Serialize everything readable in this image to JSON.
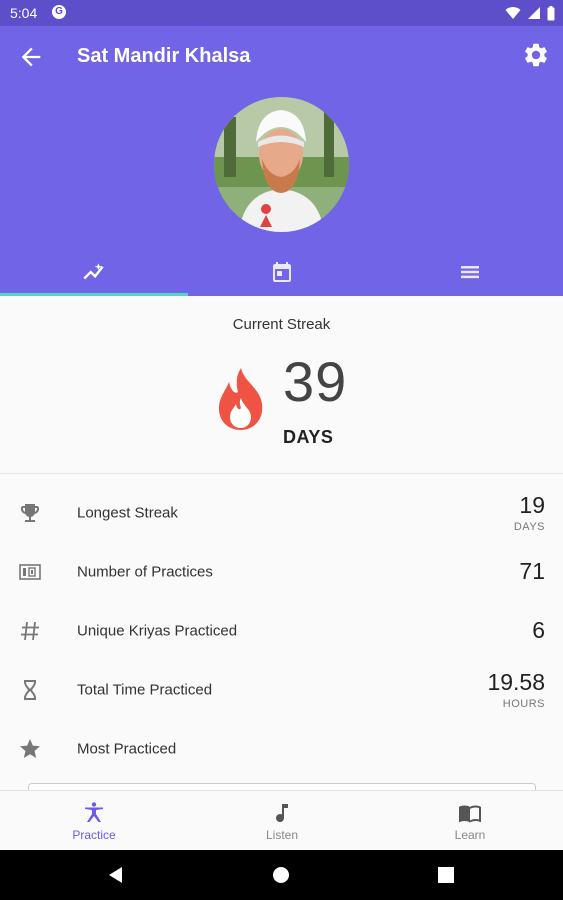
{
  "status_bar": {
    "time": "5:04",
    "g_icon": "G"
  },
  "header": {
    "title": "Sat Mandir Khalsa",
    "back_icon": "arrow-back-icon",
    "settings_icon": "gear-icon",
    "background_color": "#7264e6"
  },
  "tabs": [
    {
      "icon": "trending-chart-icon",
      "active": true
    },
    {
      "icon": "calendar-icon",
      "active": false
    },
    {
      "icon": "list-icon",
      "active": false
    }
  ],
  "streak": {
    "label": "Current Streak",
    "value": "39",
    "unit": "DAYS",
    "icon": "flame-icon",
    "flame_color": "#ef5343"
  },
  "stats": [
    {
      "icon": "trophy-icon",
      "label": "Longest Streak",
      "value": "19",
      "unit": "DAYS"
    },
    {
      "icon": "counter-icon",
      "label": "Number of Practices",
      "value": "71",
      "unit": ""
    },
    {
      "icon": "hash-icon",
      "label": "Unique Kriyas Practiced",
      "value": "6",
      "unit": ""
    },
    {
      "icon": "hourglass-icon",
      "label": "Total Time Practiced",
      "value": "19.58",
      "unit": "HOURS"
    },
    {
      "icon": "star-icon",
      "label": "Most Practiced",
      "value": "",
      "unit": ""
    }
  ],
  "bottom_nav": [
    {
      "label": "Practice",
      "icon": "yoga-pose-icon",
      "active": true
    },
    {
      "label": "Listen",
      "icon": "music-note-icon",
      "active": false
    },
    {
      "label": "Learn",
      "icon": "book-icon",
      "active": false
    }
  ],
  "accent_color": "#6b5ce7",
  "tab_indicator_color": "#4dd6c3"
}
